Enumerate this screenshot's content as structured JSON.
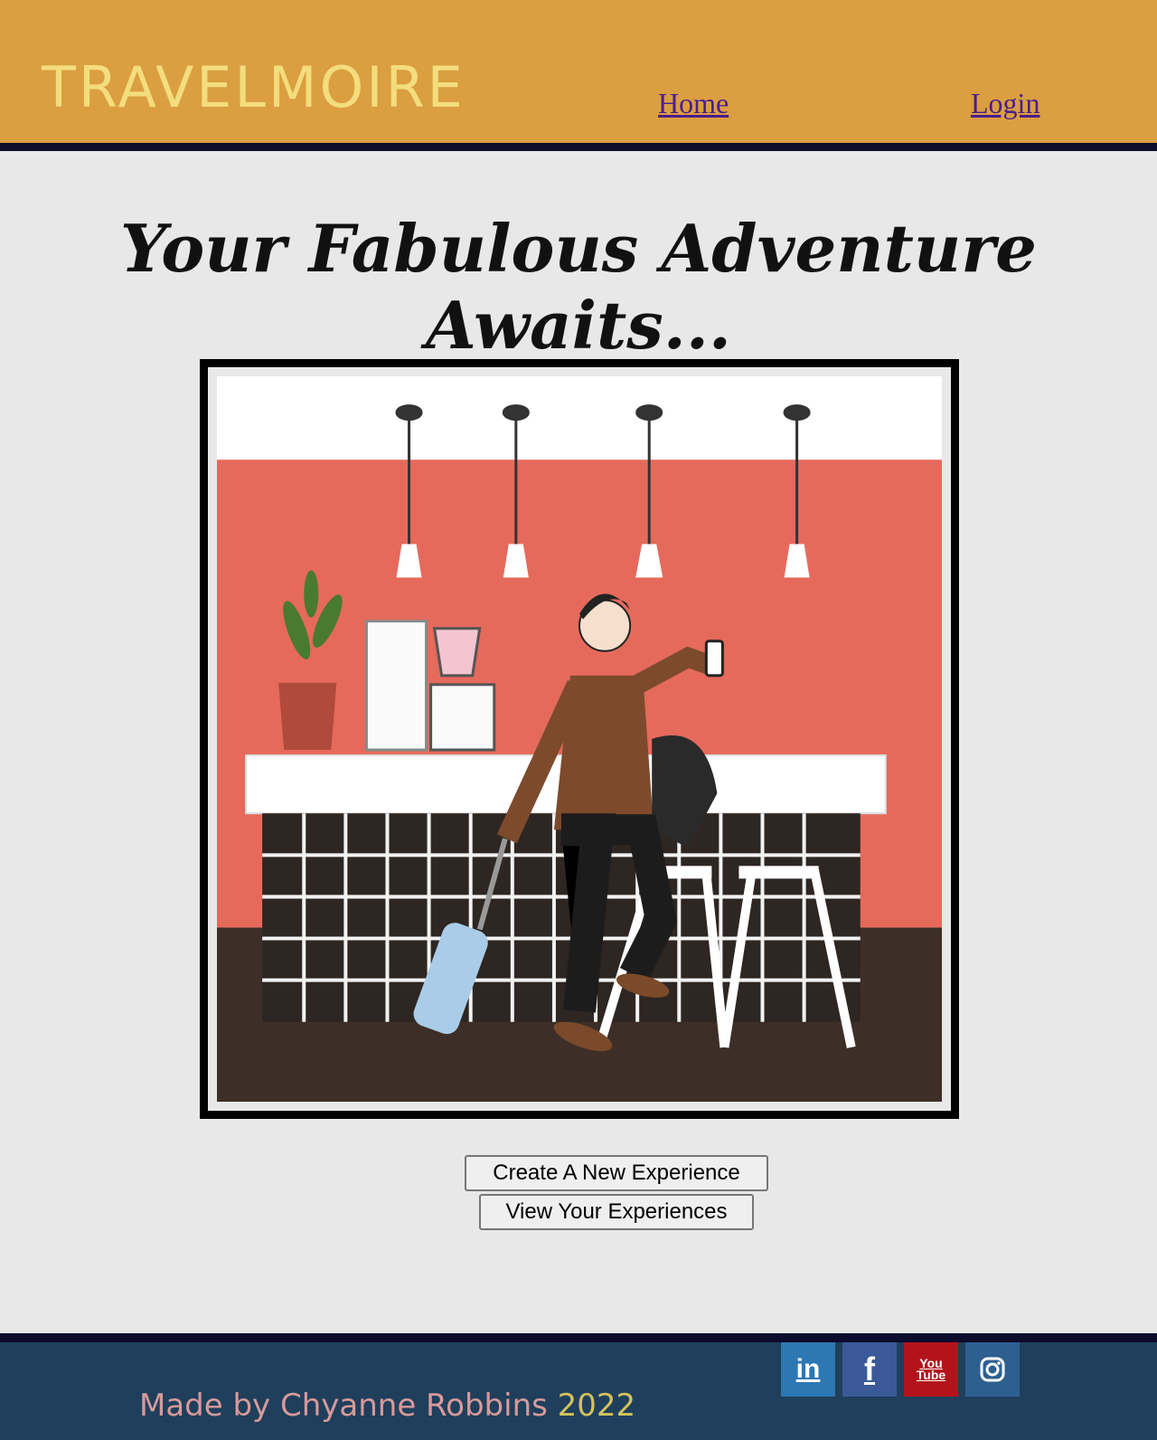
{
  "header": {
    "brand": "TRAVELMOIRE",
    "nav": [
      {
        "label": "Home"
      },
      {
        "label": "Login"
      }
    ]
  },
  "main": {
    "title": "Your Fabulous Adventure Awaits...",
    "buttons": {
      "create": "Create A New Experience",
      "view": "View Your Experiences"
    }
  },
  "footer": {
    "credit": "Made by Chyanne Robbins",
    "year": "2022",
    "social": [
      {
        "icon": "linkedin-icon",
        "glyph": "in"
      },
      {
        "icon": "facebook-icon",
        "glyph": "f"
      },
      {
        "icon": "youtube-icon",
        "glyph": "You Tube"
      },
      {
        "icon": "instagram-icon",
        "glyph": ""
      }
    ]
  },
  "colors": {
    "header_bg": "#db9e41",
    "brand": "#f3dd7c",
    "page_bg": "#e8e8e8",
    "footer_bg": "#1f3f5c",
    "accent_dark": "#0e0e2c"
  }
}
